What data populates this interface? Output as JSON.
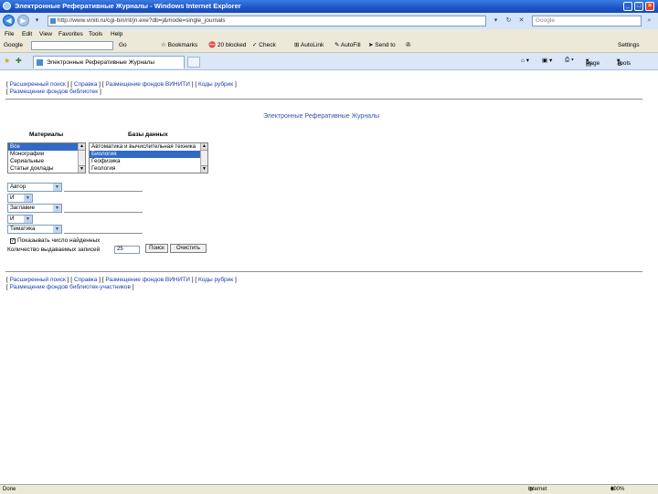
{
  "window": {
    "title": "Электронные Реферативные Журналы - Windows Internet Explorer",
    "minimize": "_",
    "maximize": "□",
    "close": "×"
  },
  "address_bar": {
    "url": "http://www.viniti.ru/cgi-bin/nt/jn.exe?db=j&mode=single_journals",
    "search_placeholder": "Google"
  },
  "menu": [
    "File",
    "Edit",
    "View",
    "Favorites",
    "Tools",
    "Help"
  ],
  "toolbar": {
    "google_label": "Google",
    "go_label": "Go",
    "bookmarks": "Bookmarks",
    "blocked": "20 blocked",
    "check": "Check",
    "autolink": "AutoLink",
    "autofill": "AutoFill",
    "send_to": "Send to",
    "settings": "Settings"
  },
  "tab": {
    "label": "Электронные Реферативные Журналы",
    "page": "Page",
    "tools": "Tools"
  },
  "content": {
    "top_nav_1": [
      "Расширенный поиск",
      "Справка",
      "Размещение фондов ВИНИТИ",
      "Коды рубрик"
    ],
    "top_nav_2": [
      "Размещение фондов библиотек"
    ],
    "page_title": "Электронные Реферативные Журналы",
    "materials_label": "Материалы",
    "databases_label": "Базы данных",
    "materials_options": [
      "Все",
      "Монографии",
      "Сериальные",
      "Статьи доклады"
    ],
    "materials_selected": 0,
    "databases_options": [
      "Автоматика и вычислительная техника",
      "Биология",
      "Геофизика",
      "Геология"
    ],
    "databases_selected": 1,
    "field1_label": "Автор",
    "op1": "И",
    "field2_label": "Заглавие",
    "op2": "И",
    "field3_label": "Тематика",
    "show_results_label": "Показывать число найденных",
    "show_results_checked": "✓",
    "records_label": "Количество выдаваемых записей",
    "records_value": "25",
    "search_button": "Поиск",
    "reset_button": "Очистить",
    "bottom_nav_1": [
      "Расширенный поиск",
      "Справка",
      "Размещение фондов ВИНИТИ",
      "Коды рубрик"
    ],
    "bottom_nav_2": [
      "Размещение фондов библиотек-участников"
    ]
  },
  "status_bar": {
    "left": "Done",
    "zone": "Internet",
    "zoom": "100%"
  }
}
